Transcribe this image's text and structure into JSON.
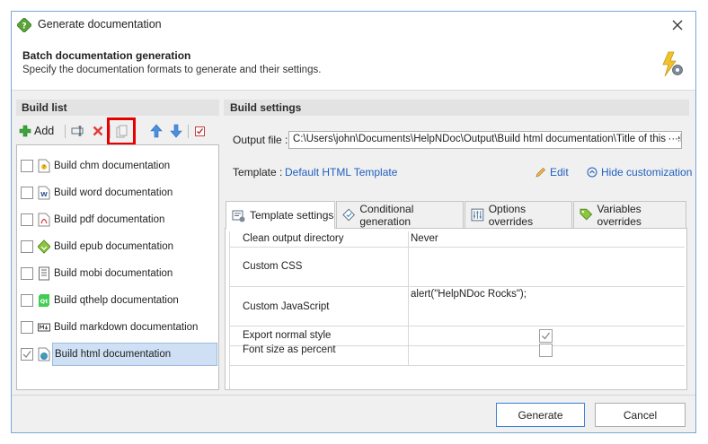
{
  "window": {
    "title": "Generate documentation"
  },
  "header": {
    "title": "Batch documentation generation",
    "subtitle": "Specify the documentation formats to generate and their settings."
  },
  "build_list": {
    "label": "Build list",
    "toolbar": {
      "add_label": "Add"
    },
    "items": [
      {
        "label": "Build chm documentation",
        "checked": false,
        "icon": "chm-icon"
      },
      {
        "label": "Build word documentation",
        "checked": false,
        "icon": "word-icon"
      },
      {
        "label": "Build pdf documentation",
        "checked": false,
        "icon": "pdf-icon"
      },
      {
        "label": "Build epub documentation",
        "checked": false,
        "icon": "epub-icon"
      },
      {
        "label": "Build mobi documentation",
        "checked": false,
        "icon": "mobi-icon"
      },
      {
        "label": "Build qthelp documentation",
        "checked": false,
        "icon": "qthelp-icon"
      },
      {
        "label": "Build markdown documentation",
        "checked": false,
        "icon": "markdown-icon"
      },
      {
        "label": "Build html documentation",
        "checked": true,
        "selected": true,
        "icon": "html-globe-icon"
      }
    ]
  },
  "build_settings": {
    "label": "Build settings",
    "output_label": "Output file :",
    "output_value": "C:\\Users\\john\\Documents\\HelpNDoc\\Output\\Build html documentation\\Title of this help",
    "output_browse": "···",
    "template_label": "Template :",
    "template_value": "Default HTML Template",
    "edit_label": "Edit",
    "hide_label": "Hide customization",
    "tabs": [
      {
        "label": "Template settings",
        "active": true
      },
      {
        "label": "Conditional generation",
        "active": false
      },
      {
        "label": "Options overrides",
        "active": false
      },
      {
        "label": "Variables overrides",
        "active": false
      }
    ],
    "rows": [
      {
        "name": "Clean output directory",
        "value": "Never"
      },
      {
        "name": "Custom CSS",
        "value": ""
      },
      {
        "name": "Custom JavaScript",
        "value": "alert(\"HelpNDoc Rocks\");"
      },
      {
        "name": "Export normal style",
        "value": "",
        "checked": true
      },
      {
        "name": "Font size as percent",
        "value": "",
        "checked": false
      }
    ]
  },
  "footer": {
    "generate_label": "Generate",
    "cancel_label": "Cancel"
  },
  "colors": {
    "accent": "#3c7fd8",
    "link": "#1f5fbf",
    "highlight": "#e60000",
    "selection": "#cfe0f5"
  }
}
